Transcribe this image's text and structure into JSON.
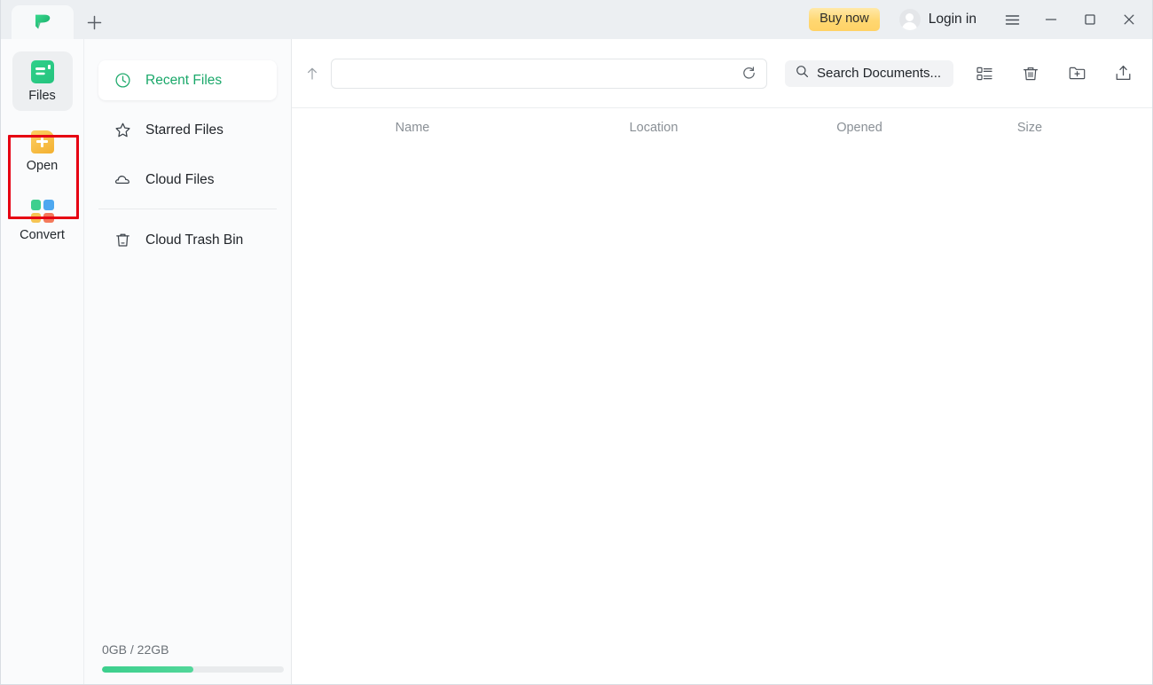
{
  "titlebar": {
    "logo_icon": "pdf-flag-logo",
    "new_tab_icon": "plus-icon",
    "buy_now_label": "Buy now",
    "avatar_icon": "user-avatar-icon",
    "login_label": "Login in",
    "menu_icon": "hamburger-menu-icon",
    "minimize_icon": "minimize-icon",
    "maximize_icon": "maximize-icon",
    "close_icon": "close-icon"
  },
  "rail": {
    "items": [
      {
        "label": "Files",
        "icon": "files-icon",
        "active": true,
        "highlighted": false
      },
      {
        "label": "Open",
        "icon": "open-file-icon",
        "active": false,
        "highlighted": true
      },
      {
        "label": "Convert",
        "icon": "convert-icon",
        "active": false,
        "highlighted": false
      }
    ],
    "convert_colors": [
      "#3ecf8e",
      "#4ea8f0",
      "#f6c453",
      "#f4795b"
    ],
    "highlight_color": "#e60012"
  },
  "sidebar": {
    "items": [
      {
        "label": "Recent Files",
        "icon": "clock-icon",
        "active": true
      },
      {
        "label": "Starred Files",
        "icon": "star-icon",
        "active": false
      },
      {
        "label": "Cloud Files",
        "icon": "cloud-icon",
        "active": false
      },
      {
        "label": "Cloud Trash Bin",
        "icon": "trash-icon",
        "active": false
      }
    ],
    "accent_color": "#1aa86a",
    "storage": {
      "text": "0GB / 22GB",
      "used_percent": 50,
      "bar_color": "#3ccf8d"
    }
  },
  "toolbar": {
    "up_icon": "arrow-up-icon",
    "path_value": "",
    "path_placeholder": "",
    "refresh_icon": "refresh-icon",
    "search_icon": "search-icon",
    "search_value": "",
    "search_placeholder": "Search Documents...",
    "actions": [
      {
        "icon": "list-view-icon"
      },
      {
        "icon": "trash-icon"
      },
      {
        "icon": "new-folder-icon"
      },
      {
        "icon": "upload-icon"
      }
    ]
  },
  "file_table": {
    "columns": [
      "Name",
      "Location",
      "Opened",
      "Size"
    ],
    "rows": []
  }
}
